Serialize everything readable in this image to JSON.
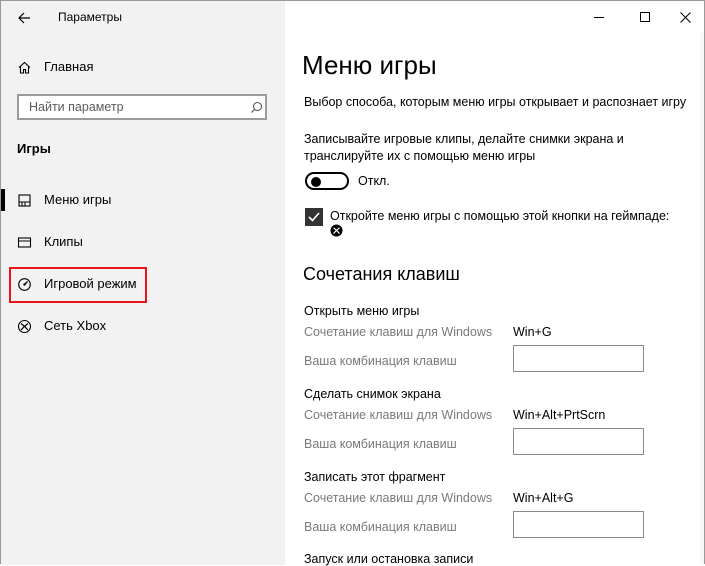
{
  "window": {
    "title": "Параметры",
    "back_icon": "back-arrow-icon",
    "minimize_icon": "minimize-icon",
    "maximize_icon": "maximize-icon",
    "close_icon": "close-icon"
  },
  "sidebar": {
    "home_label": "Главная",
    "home_icon": "home-icon",
    "search": {
      "placeholder": "Найти параметр",
      "icon": "search-icon"
    },
    "section_label": "Игры",
    "items": [
      {
        "label": "Меню игры",
        "icon": "game-bar-icon",
        "selected": true
      },
      {
        "label": "Клипы",
        "icon": "clips-icon",
        "selected": false
      },
      {
        "label": "Игровой режим",
        "icon": "game-mode-icon",
        "selected": false,
        "highlighted": true
      },
      {
        "label": "Сеть Xbox",
        "icon": "xbox-icon",
        "selected": false
      }
    ],
    "highlight_color": "#e8141c"
  },
  "main": {
    "title": "Меню игры",
    "description": "Выбор способа, которым меню игры открывает и распознает игру",
    "record_text_line1": "Записывайте игровые клипы, делайте снимки экрана и",
    "record_text_line2": "транслируйте их с помощью меню игры",
    "toggle_label": "Откл.",
    "toggle_on": false,
    "checkbox_label": "Откройте меню игры с помощью этой кнопки на геймпаде:",
    "checkbox_checked": true,
    "shortcuts_title": "Сочетания клавиш",
    "windows_shortcut_label": "Сочетание клавиш для Windows",
    "custom_shortcut_label": "Ваша комбинация клавиш",
    "shortcuts": [
      {
        "title": "Открыть меню игры",
        "windows_value": "Win+G",
        "custom_value": ""
      },
      {
        "title": "Сделать снимок экрана",
        "windows_value": "Win+Alt+PrtScrn",
        "custom_value": ""
      },
      {
        "title": "Записать этот фрагмент",
        "windows_value": "Win+Alt+G",
        "custom_value": ""
      }
    ],
    "next_section_title": "Запуск или остановка записи"
  }
}
